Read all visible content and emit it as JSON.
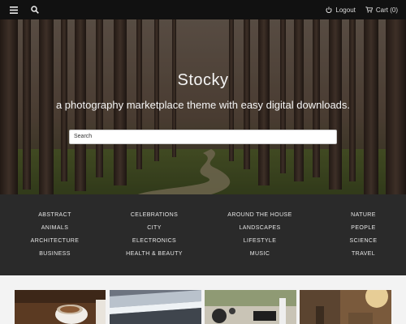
{
  "topbar": {
    "menu_icon": "hamburger-menu-icon",
    "search_icon": "search-icon",
    "logout_label": "Logout",
    "cart_label": "Cart (0)"
  },
  "hero": {
    "title": "Stocky",
    "subtitle": "a photography marketplace theme with easy digital downloads.",
    "search_placeholder": "Search"
  },
  "categories": {
    "columns": [
      [
        "ABSTRACT",
        "ANIMALS",
        "ARCHITECTURE",
        "BUSINESS"
      ],
      [
        "CELEBRATIONS",
        "CITY",
        "ELECTRONICS",
        "HEALTH & BEAUTY"
      ],
      [
        "AROUND THE HOUSE",
        "LANDSCAPES",
        "LIFESTYLE",
        "MUSIC"
      ],
      [
        "NATURE",
        "PEOPLE",
        "SCIENCE",
        "TRAVEL"
      ]
    ]
  },
  "thumbnails": [
    "coffee-cup-photo",
    "train-motion-photo",
    "street-piano-photo",
    "city-sunlight-photo"
  ],
  "colors": {
    "topbar_bg": "#111111",
    "category_bg": "#2a2a2a",
    "category_text": "#e6e6e6",
    "hero_text": "#f4f4f4"
  }
}
